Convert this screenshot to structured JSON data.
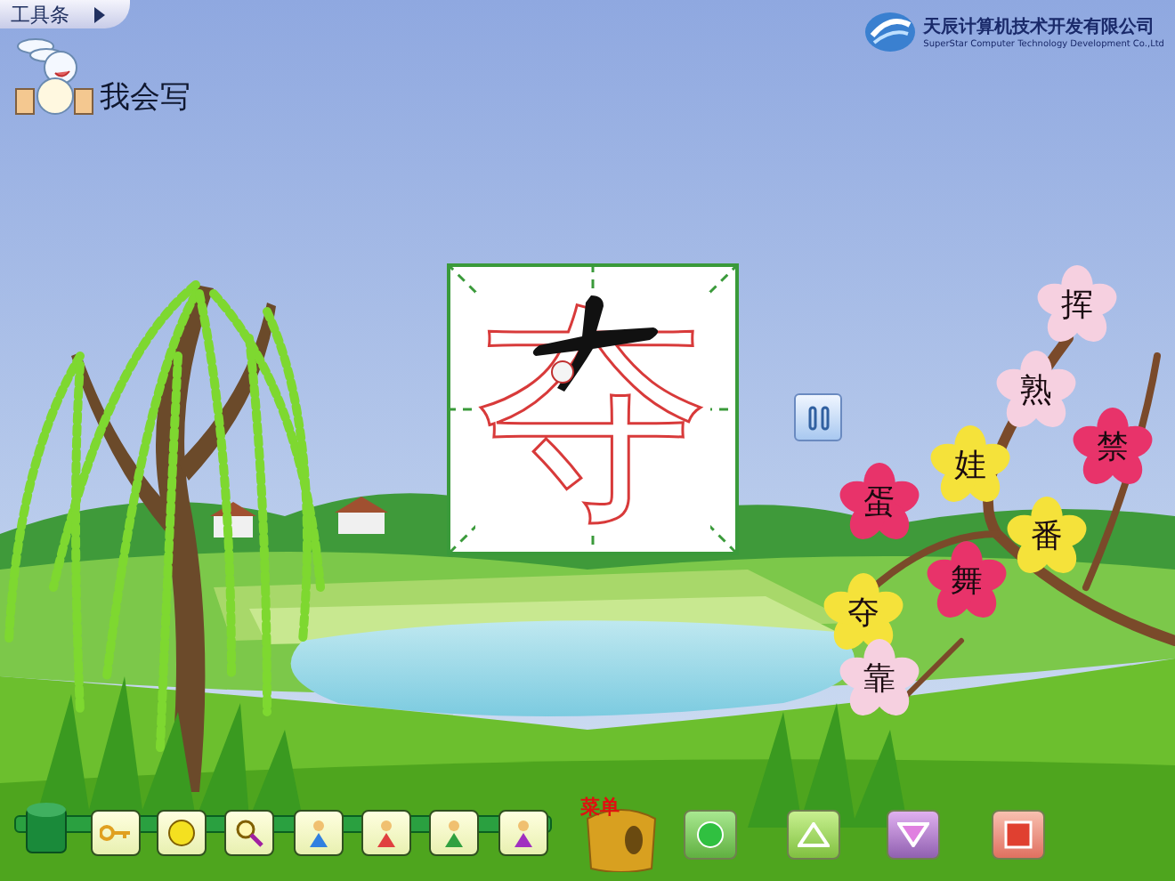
{
  "toolbar_tab": {
    "label": "工具条"
  },
  "company": {
    "name": "天辰计算机技术开发有限公司",
    "name_en": "SuperStar Computer Technology Development Co.,Ltd"
  },
  "title": "我会写",
  "practice": {
    "character": "夺"
  },
  "flowers": [
    {
      "word": "挥",
      "color": "#f6d0e0"
    },
    {
      "word": "熟",
      "color": "#f6d0e0"
    },
    {
      "word": "禁",
      "color": "#e8336a"
    },
    {
      "word": "娃",
      "color": "#f5e23a"
    },
    {
      "word": "蛋",
      "color": "#e8336a"
    },
    {
      "word": "番",
      "color": "#f5e23a"
    },
    {
      "word": "舞",
      "color": "#e8336a"
    },
    {
      "word": "夺",
      "color": "#f5e23a"
    },
    {
      "word": "靠",
      "color": "#f6d0e0"
    }
  ],
  "menu": {
    "label": "菜单"
  }
}
